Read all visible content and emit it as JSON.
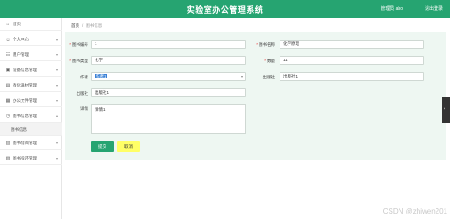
{
  "app": {
    "title": "实验室办公管理系统",
    "user_label": "管理员 abo",
    "logout_label": "退出登录"
  },
  "sidebar": {
    "items": [
      {
        "label": "首页",
        "icon": "home-icon",
        "glyph": "⌂"
      },
      {
        "label": "个人中心",
        "icon": "person-icon",
        "glyph": "👤"
      },
      {
        "label": "用户管理",
        "icon": "users-icon",
        "glyph": "👥"
      },
      {
        "label": "设备信息管理",
        "icon": "device-icon",
        "glyph": "▣"
      },
      {
        "label": "教化器材管理",
        "icon": "equipment-icon",
        "glyph": "▤"
      },
      {
        "label": "办公文件管理",
        "icon": "file-icon",
        "glyph": "▦"
      },
      {
        "label": "图书信息管理",
        "icon": "book-icon",
        "glyph": "◷"
      },
      {
        "label": "图书信息",
        "icon": "",
        "glyph": ""
      },
      {
        "label": "图书借阅管理",
        "icon": "borrow-icon",
        "glyph": "▥"
      },
      {
        "label": "图书归还管理",
        "icon": "return-icon",
        "glyph": "▧"
      }
    ]
  },
  "breadcrumb": {
    "home": "首页",
    "current": "图书信息"
  },
  "form": {
    "book_no_label": "图书编号",
    "book_no_value": "1",
    "book_name_label": "图书名称",
    "book_name_value": "化学原理",
    "book_type_label": "图书类型",
    "book_type_value": "化学",
    "quantity_label": "数量",
    "quantity_value": "11",
    "author_label": "作者",
    "author_value": "作者1",
    "publisher_label": "出版社",
    "publisher_value": "出版社1",
    "press_label": "出版社",
    "press_value": "出版社1",
    "detail_label": "详情",
    "detail_value": "详情1",
    "submit_label": "提交",
    "cancel_label": "取消"
  },
  "watermark": "CSDN @zhiwen201"
}
